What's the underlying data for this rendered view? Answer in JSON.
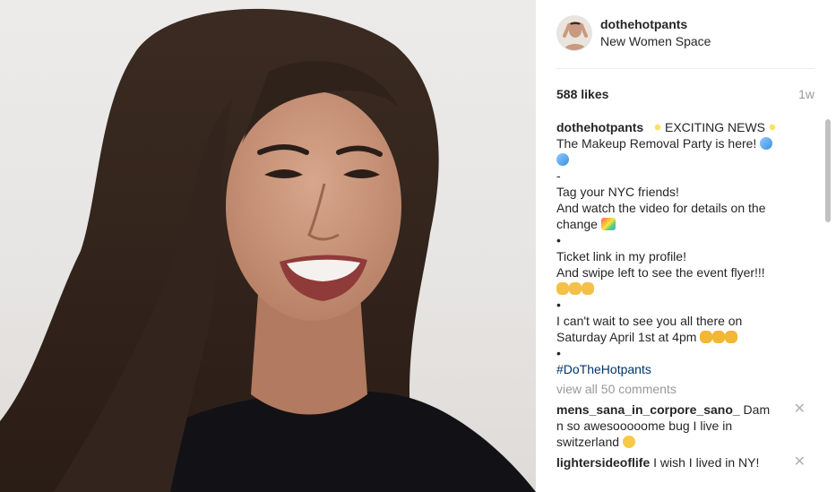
{
  "post": {
    "username": "dothehotpants",
    "location": "New Women Space",
    "likes": "588 likes",
    "age": "1w"
  },
  "caption": {
    "author": "dothehotpants",
    "l1": "EXCITING NEWS",
    "l2": "The Makeup Removal Party is here!",
    "l3": "-",
    "l4": "Tag your NYC friends!",
    "l5": "And watch the video for details on the",
    "l6": "change",
    "l7": "•",
    "l8": "Ticket link in my profile!",
    "l9": "And swipe left to see the event flyer!!!",
    "l10": "•",
    "l11": "I can't wait to see you all there on",
    "l12": "Saturday April 1st at 4pm",
    "l13": "•",
    "hashtag": "#DoTheHotpants"
  },
  "view_all": "view all 50 comments",
  "comments": [
    {
      "user": "mens_sana_in_corpore_sano_",
      "text_a": "Dam",
      "text_b": "n so awesooooome bug I live in",
      "text_c": "switzerland"
    },
    {
      "user": "lightersideoflife",
      "text": "I wish I lived in NY!"
    }
  ],
  "icons": {
    "close": "close-icon",
    "sparkles": "sparkles-emoji",
    "droplets": "sweat-droplets-emoji",
    "rainbow": "rainbow-emoji",
    "pointing": "pointing-left-emoji",
    "raised_hands": "raised-hands-emoji",
    "sad": "persevering-face-emoji"
  },
  "colors": {
    "text": "#262626",
    "muted": "#999999",
    "hashtag": "#003569",
    "divider": "#efefef"
  }
}
